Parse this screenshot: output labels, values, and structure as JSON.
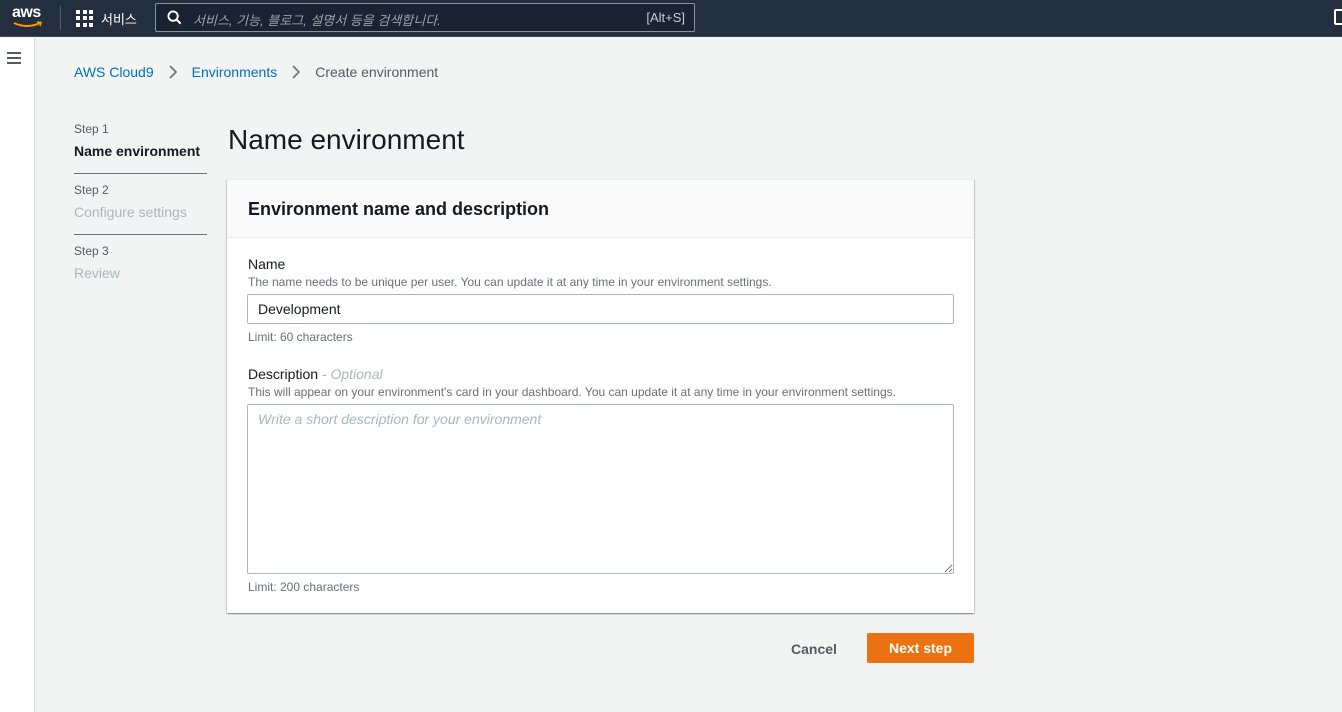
{
  "nav": {
    "logo_text": "aws",
    "services_label": "서비스",
    "search_placeholder": "서비스, 기능, 블로그, 설명서 등을 검색합니다.",
    "search_shortcut": "[Alt+S]"
  },
  "breadcrumbs": [
    {
      "label": "AWS Cloud9",
      "link": true
    },
    {
      "label": "Environments",
      "link": true
    },
    {
      "label": "Create environment",
      "link": false
    }
  ],
  "steps": [
    {
      "number": "Step 1",
      "title": "Name environment",
      "active": true
    },
    {
      "number": "Step 2",
      "title": "Configure settings",
      "active": false
    },
    {
      "number": "Step 3",
      "title": "Review",
      "active": false
    }
  ],
  "page_title": "Name environment",
  "panel": {
    "header": "Environment name and description",
    "name": {
      "label": "Name",
      "description": "The name needs to be unique per user. You can update it at any time in your environment settings.",
      "value": "Development",
      "constraint": "Limit: 60 characters"
    },
    "description": {
      "label": "Description",
      "optional": " - Optional",
      "description": "This will appear on your environment's card in your dashboard. You can update it at any time in your environment settings.",
      "placeholder": "Write a short description for your environment",
      "constraint": "Limit: 200 characters"
    }
  },
  "actions": {
    "cancel": "Cancel",
    "next": "Next step"
  },
  "colors": {
    "nav_bg": "#232f3e",
    "link": "#0073bb",
    "primary_button": "#ec7211"
  }
}
